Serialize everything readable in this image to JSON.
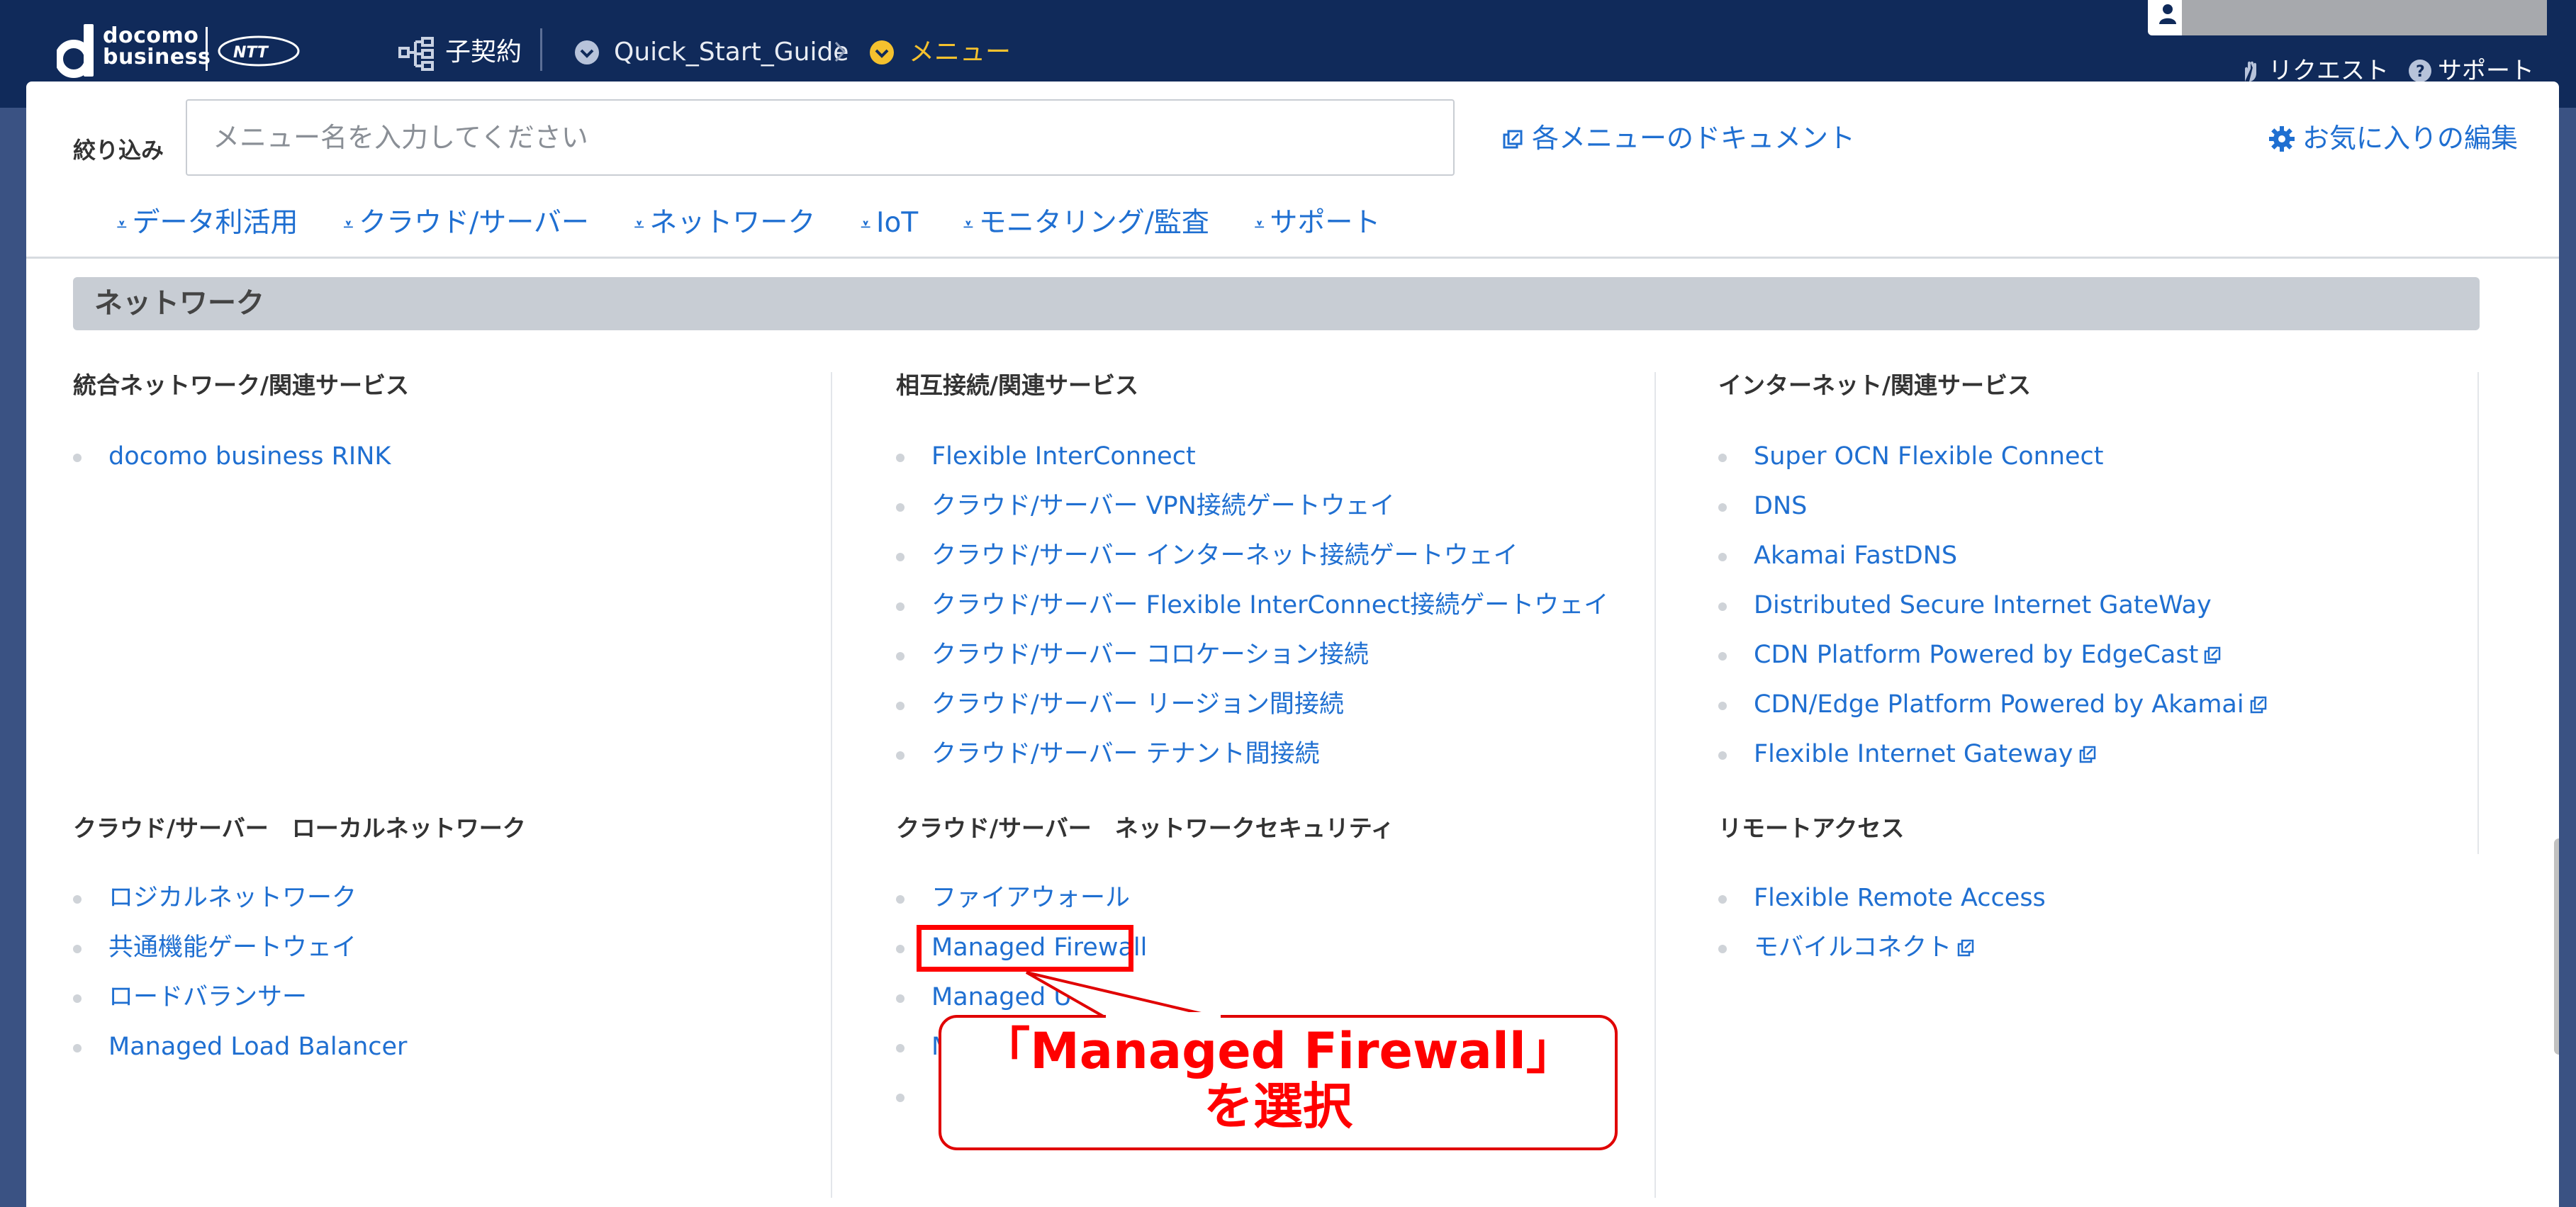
{
  "header": {
    "brand_top": "docomo",
    "brand_bottom": "business",
    "partner_brand": "NTT Communications",
    "contract_label": "子契約",
    "breadcrumb": [
      "Quick_Start_Guide",
      "メニュー"
    ],
    "request_label": "リクエスト",
    "support_label": "サポート"
  },
  "filter": {
    "label": "絞り込み",
    "placeholder": "メニュー名を入力してください",
    "value": ""
  },
  "doc_link": "各メニューのドキュメント",
  "fav_link": "お気に入りの編集",
  "anchors": [
    "データ利活用",
    "クラウド/サーバー",
    "ネットワーク",
    "IoT",
    "モニタリング/監査",
    "サポート"
  ],
  "section": {
    "title": "ネットワーク",
    "groups": [
      {
        "title": "統合ネットワーク/関連サービス",
        "items": [
          {
            "label": "docomo business RINK",
            "external": false
          }
        ]
      },
      {
        "title": "相互接続/関連サービス",
        "items": [
          {
            "label": "Flexible InterConnect",
            "external": false
          },
          {
            "label": "クラウド/サーバー VPN接続ゲートウェイ",
            "external": false
          },
          {
            "label": "クラウド/サーバー インターネット接続ゲートウェイ",
            "external": false
          },
          {
            "label": "クラウド/サーバー Flexible InterConnect接続ゲートウェイ",
            "external": false
          },
          {
            "label": "クラウド/サーバー コロケーション接続",
            "external": false
          },
          {
            "label": "クラウド/サーバー リージョン間接続",
            "external": false
          },
          {
            "label": "クラウド/サーバー テナント間接続",
            "external": false
          }
        ]
      },
      {
        "title": "インターネット/関連サービス",
        "items": [
          {
            "label": "Super OCN Flexible Connect",
            "external": false
          },
          {
            "label": "DNS",
            "external": false
          },
          {
            "label": "Akamai FastDNS",
            "external": false
          },
          {
            "label": "Distributed Secure Internet GateWay",
            "external": false
          },
          {
            "label": "CDN Platform Powered by EdgeCast",
            "external": true
          },
          {
            "label": "CDN/Edge Platform Powered by Akamai",
            "external": true
          },
          {
            "label": "Flexible Internet Gateway",
            "external": true
          }
        ]
      },
      {
        "title": "クラウド/サーバー　ローカルネットワーク",
        "items": [
          {
            "label": "ロジカルネットワーク",
            "external": false
          },
          {
            "label": "共通機能ゲートウェイ",
            "external": false
          },
          {
            "label": "ロードバランサー",
            "external": false
          },
          {
            "label": "Managed Load Balancer",
            "external": false
          }
        ]
      },
      {
        "title": "クラウド/サーバー　ネットワークセキュリティ",
        "items": [
          {
            "label": "ファイアウォール",
            "external": false
          },
          {
            "label": "Managed Firewall",
            "external": false
          },
          {
            "label": "Managed U",
            "external": false
          },
          {
            "label": "M",
            "external": false
          },
          {
            "label": "",
            "external": false
          }
        ]
      },
      {
        "title": "リモートアクセス",
        "items": [
          {
            "label": "Flexible Remote Access",
            "external": false
          },
          {
            "label": "モバイルコネクト",
            "external": true
          }
        ]
      }
    ]
  },
  "annotation": {
    "line1": "「Managed Firewall」",
    "line2": "を選択",
    "color": "#ff0000"
  },
  "colors": {
    "header": "#102a5a",
    "link": "#1f6fd1",
    "section_bar": "#c8cdd4",
    "accent": "#f4c12e"
  }
}
